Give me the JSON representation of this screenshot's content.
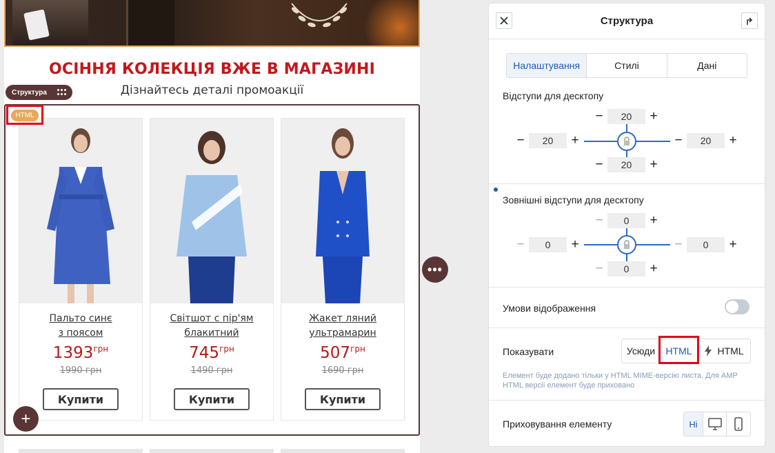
{
  "promo": {
    "title": "ОСІННЯ КОЛЕКЦІЯ ВЖЕ В МАГАЗИНІ",
    "subtitle": "Дізнайтесь деталі промоакції"
  },
  "structure_pill": {
    "label": "Структура"
  },
  "html_badge": "HTML",
  "products": [
    {
      "name1": "Пальто синє",
      "name2": "з поясом",
      "price": "1393",
      "currency": "грн",
      "old_price": "1990 грн",
      "buy": "Купити"
    },
    {
      "name1": "Світшот с пір'ям",
      "name2": "блакитний",
      "price": "745",
      "currency": "грн",
      "old_price": "1490 грн",
      "buy": "Купити"
    },
    {
      "name1": "Жакет ляний",
      "name2": "ультрамарин",
      "price": "507",
      "currency": "грн",
      "old_price": "1690 грн",
      "buy": "Купити"
    }
  ],
  "add_button": "+",
  "more_button": "•••",
  "panel": {
    "title": "Структура",
    "tabs": [
      "Налаштування",
      "Стилі",
      "Дані"
    ],
    "active_tab": "Налаштування",
    "padding": {
      "label": "Відступи для десктопу",
      "top": "20",
      "left": "20",
      "right": "20",
      "bottom": "20"
    },
    "margin": {
      "label": "Зовнішні відступи для десктопу",
      "top": "0",
      "left": "0",
      "right": "0",
      "bottom": "0"
    },
    "display_conditions": {
      "label": "Умови відображення",
      "enabled": false
    },
    "show": {
      "label": "Показувати",
      "options": [
        "Усюди",
        "HTML",
        "HTML"
      ],
      "selected": "HTML",
      "note": "Елемент буде додано тільки у HTML MIME-версію листа. Для AMP HTML версії елемент буде приховано"
    },
    "hide": {
      "label": "Приховування елементу",
      "none_label": "Ні"
    }
  },
  "colors": {
    "accent": "#1a5bb5",
    "promo_red": "#c4161c",
    "price_red": "#b21a1a",
    "dark_brown": "#5a3535",
    "highlight": "#e3001b",
    "badge": "#e8a85a"
  },
  "icons": [
    "close-icon",
    "collapse-arrow-icon",
    "lock-icon",
    "lightning-icon",
    "desktop-icon",
    "mobile-icon",
    "drag-dots-icon",
    "plus-icon",
    "ellipsis-icon"
  ]
}
